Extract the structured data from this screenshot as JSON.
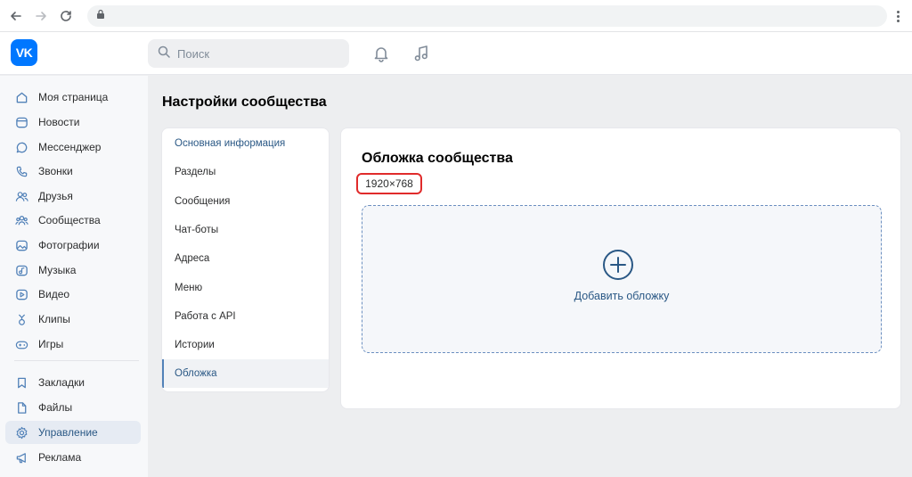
{
  "browser": {
    "url_value": ""
  },
  "header": {
    "logo_text": "VK",
    "search_placeholder": "Поиск"
  },
  "sidebar": {
    "items": [
      {
        "label": "Моя страница",
        "icon": "home-icon"
      },
      {
        "label": "Новости",
        "icon": "news-icon"
      },
      {
        "label": "Мессенджер",
        "icon": "message-icon"
      },
      {
        "label": "Звонки",
        "icon": "phone-icon"
      },
      {
        "label": "Друзья",
        "icon": "friends-icon"
      },
      {
        "label": "Сообщества",
        "icon": "communities-icon"
      },
      {
        "label": "Фотографии",
        "icon": "photo-icon"
      },
      {
        "label": "Музыка",
        "icon": "music-icon"
      },
      {
        "label": "Видео",
        "icon": "video-icon"
      },
      {
        "label": "Клипы",
        "icon": "clips-icon"
      },
      {
        "label": "Игры",
        "icon": "gamepad-icon"
      }
    ],
    "items_secondary": [
      {
        "label": "Закладки",
        "icon": "bookmark-icon"
      },
      {
        "label": "Файлы",
        "icon": "file-icon"
      },
      {
        "label": "Управление",
        "icon": "gear-icon",
        "active": true
      },
      {
        "label": "Реклама",
        "icon": "megaphone-icon"
      }
    ]
  },
  "page": {
    "title": "Настройки сообщества"
  },
  "settings_menu": {
    "items": [
      {
        "label": "Основная информация"
      },
      {
        "label": "Разделы"
      },
      {
        "label": "Сообщения"
      },
      {
        "label": "Чат-боты"
      },
      {
        "label": "Адреса"
      },
      {
        "label": "Меню"
      },
      {
        "label": "Работа с API"
      },
      {
        "label": "Истории"
      },
      {
        "label": "Обложка",
        "active": true
      }
    ]
  },
  "cover": {
    "title": "Обложка сообщества",
    "dimensions": "1920×768",
    "add_label": "Добавить обложку"
  },
  "colors": {
    "brand": "#0077ff",
    "link": "#2a5885",
    "highlight": "#e02b2b"
  }
}
